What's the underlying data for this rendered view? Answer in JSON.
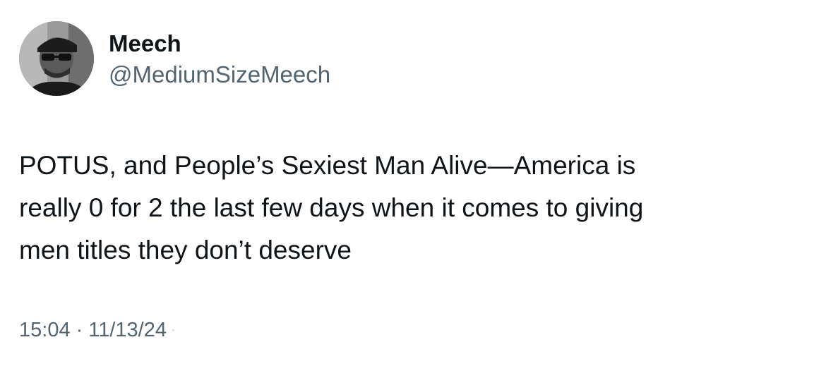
{
  "author": {
    "display_name": "Meech",
    "handle": "@MediumSizeMeech",
    "avatar_icon": "user-avatar-photo"
  },
  "tweet": {
    "text": "POTUS, and People’s Sexiest Man Alive—America is\nreally 0 for 2 the last few days when it comes to giving\nmen titles they don’t deserve"
  },
  "meta": {
    "time": "15:04",
    "separator": "·",
    "date": "11/13/24"
  },
  "colors": {
    "primary_text": "#0f1419",
    "secondary_text": "#536471",
    "background": "#ffffff"
  }
}
